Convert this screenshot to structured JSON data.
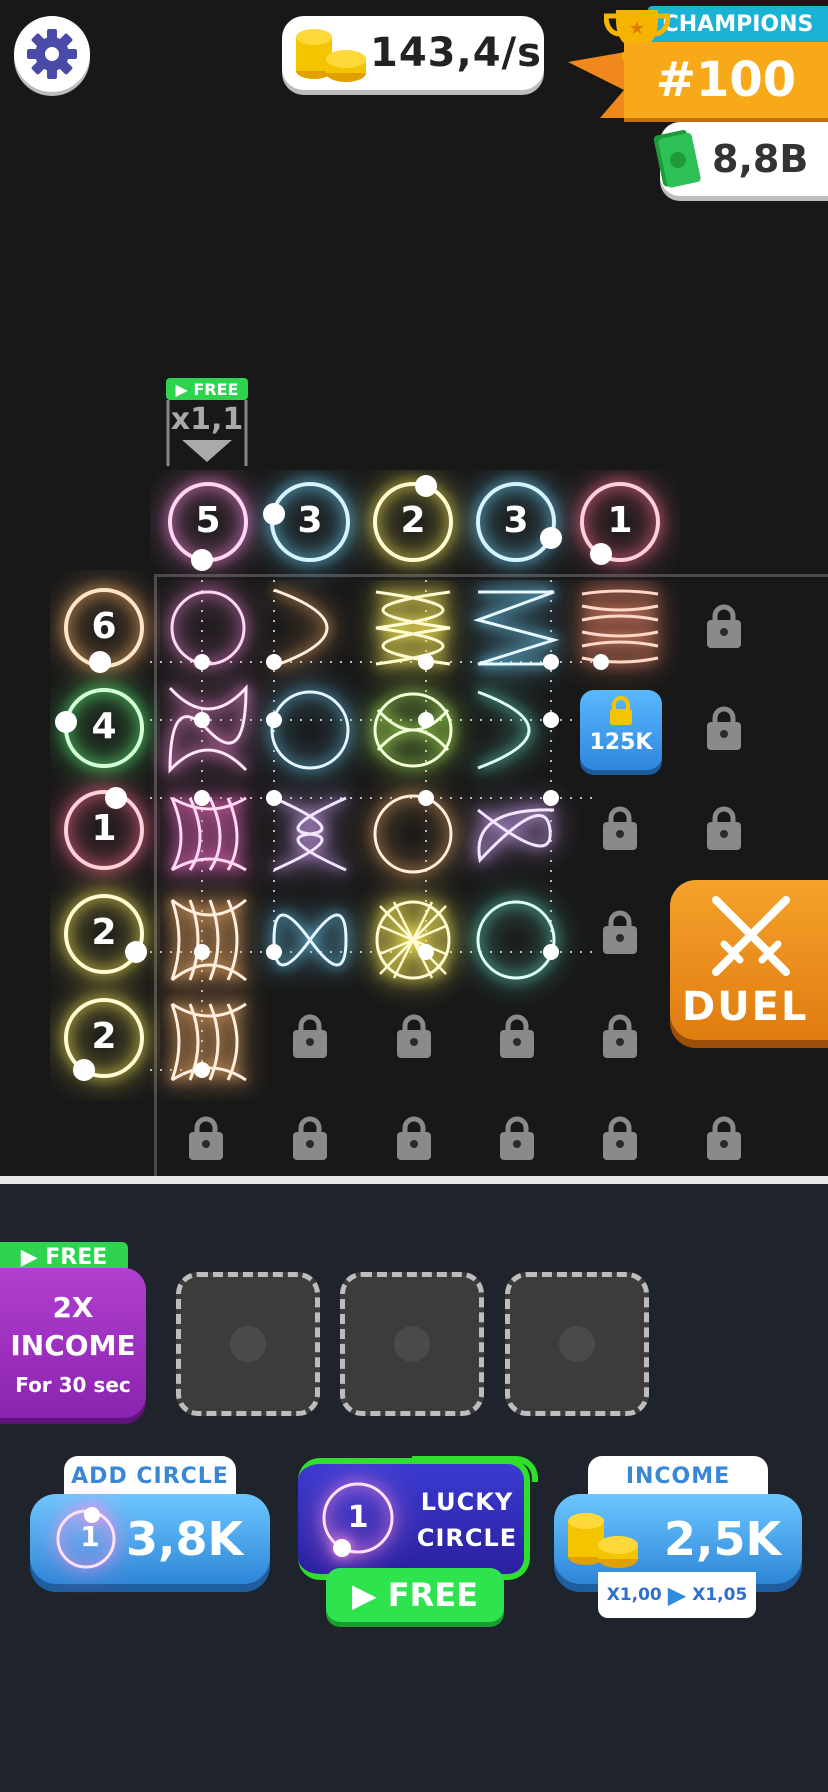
{
  "header": {
    "income_rate": "143,4/s",
    "champions_label": "CHAMPIONS",
    "rank": "#100",
    "cash": "8,8B"
  },
  "board": {
    "free_tag": "▶ FREE",
    "multiplier": "x1,1",
    "top_circles": [
      "5",
      "3",
      "2",
      "3",
      "1"
    ],
    "left_circles": [
      "6",
      "4",
      "1",
      "2",
      "2"
    ],
    "unlock_cost": "125K",
    "colors": {
      "pink": "#ff6fd0",
      "blue": "#6fd6ff",
      "yellow": "#fff05a",
      "red": "#ff6f8f",
      "orange": "#ffb56a",
      "green": "#5dff7a"
    }
  },
  "duel": {
    "label": "DUEL"
  },
  "boost": {
    "free_label": "▶ FREE",
    "line1": "2X",
    "line2": "INCOME",
    "line3": "For 30 sec"
  },
  "actions": {
    "add_circle_label": "ADD CIRCLE",
    "add_circle_level": "1",
    "add_circle_cost": "3,8K",
    "lucky_level": "1",
    "lucky_line1": "LUCKY",
    "lucky_line2": "CIRCLE",
    "lucky_free": "▶ FREE",
    "income_label": "INCOME",
    "income_cost": "2,5K",
    "income_from": "X1,00",
    "income_to": "X1,05"
  }
}
